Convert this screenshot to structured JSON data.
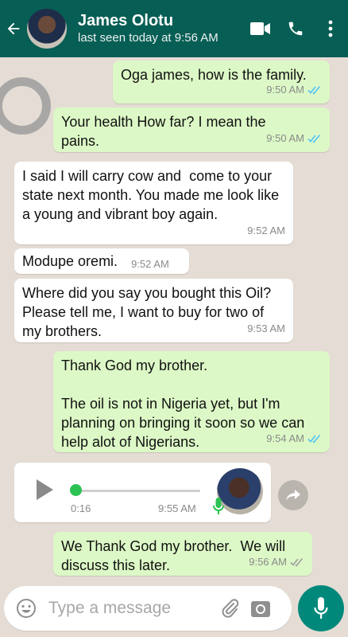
{
  "header": {
    "contact_name": "James Olotu",
    "last_seen": "last seen today at 9:56 AM"
  },
  "messages": [
    {
      "direction": "out",
      "text": "Oga james, how is the family.",
      "time": "9:50 AM",
      "status": "read"
    },
    {
      "direction": "out",
      "text": "Your health How far? I mean the pains.",
      "time": "9:50 AM",
      "status": "read"
    },
    {
      "direction": "in",
      "text": "I said I will carry cow and  come to your state next month. You made me look like a young and vibrant boy again.",
      "time": "9:52 AM"
    },
    {
      "direction": "in",
      "text": "Modupe oremi.",
      "time": "9:52 AM"
    },
    {
      "direction": "in",
      "text": "Where did you say you bought this Oil? Please tell me, I want to buy for two of my brothers.",
      "time": "9:53 AM"
    },
    {
      "direction": "out",
      "text": "Thank God my brother.\n\nThe oil is not in Nigeria yet, but I'm planning on bringing it soon so we can help alot of Nigerians.",
      "time": "9:54 AM",
      "status": "read"
    },
    {
      "direction": "in",
      "type": "voice",
      "duration": "0:16",
      "time": "9:55 AM",
      "progress": 0.0
    },
    {
      "direction": "out",
      "text": "We Thank God my brother.  We will discuss this later.",
      "time": "9:56 AM",
      "status": "delivered"
    }
  ],
  "composer": {
    "placeholder": "Type a message"
  },
  "colors": {
    "header": "#075e54",
    "outgoing_bubble": "#dcf8c6",
    "incoming_bubble": "#ffffff",
    "read_ticks": "#4fc3f7",
    "delivered_ticks": "#9e9e9e",
    "voice_knob": "#2bc253",
    "send_button": "#00897b"
  },
  "icons": [
    "back-arrow-icon",
    "video-call-icon",
    "phone-icon",
    "more-options-icon",
    "play-icon",
    "microphone-icon",
    "forward-icon",
    "emoji-icon",
    "attach-icon",
    "camera-icon"
  ]
}
